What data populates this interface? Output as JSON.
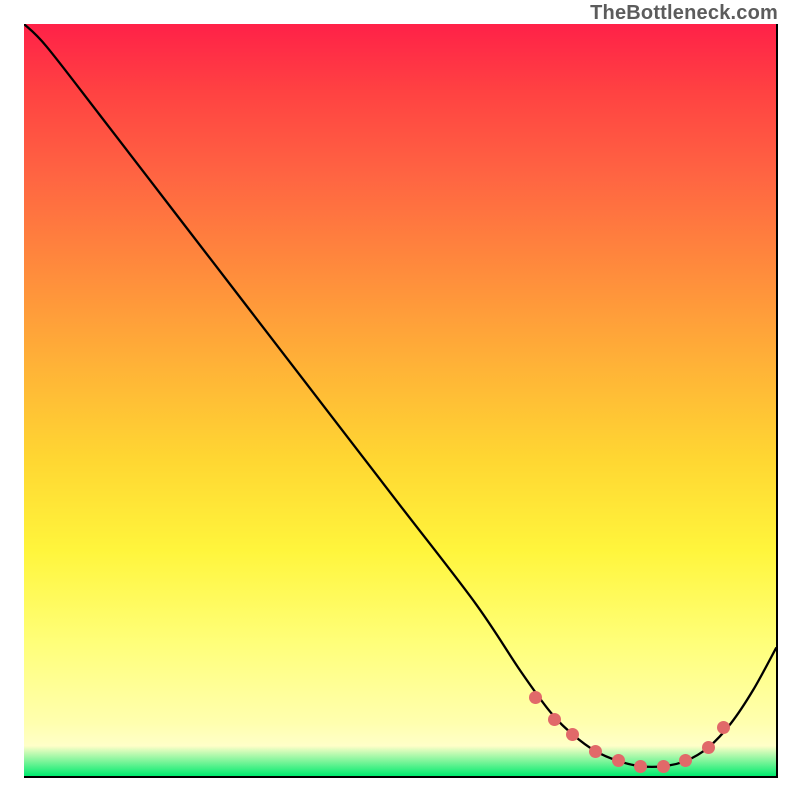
{
  "attribution": "TheBottleneck.com",
  "chart_data": {
    "type": "line",
    "title": "",
    "xlabel": "",
    "ylabel": "",
    "xlim": [
      0,
      100
    ],
    "ylim": [
      0,
      100
    ],
    "series": [
      {
        "name": "curve",
        "x": [
          0,
          3,
          10,
          20,
          30,
          40,
          50,
          60,
          66,
          70,
          73,
          76,
          79,
          82,
          85,
          88,
          91,
          94,
          97,
          100
        ],
        "y": [
          100,
          97,
          88,
          75,
          62,
          49,
          36,
          23,
          14,
          8.5,
          5.5,
          3.3,
          2.0,
          1.3,
          1.3,
          2.0,
          3.8,
          7.0,
          11.5,
          17
        ]
      },
      {
        "name": "markers",
        "x": [
          68.0,
          70.5,
          73.0,
          76.0,
          79.0,
          82.0,
          85.0,
          88.0,
          91.0,
          93.0
        ],
        "y": [
          10.5,
          7.5,
          5.5,
          3.3,
          2.0,
          1.3,
          1.3,
          2.0,
          3.8,
          6.5
        ]
      }
    ],
    "gradient": {
      "type": "vertical",
      "stops": [
        {
          "pos": 0.0,
          "color": "#ff2148"
        },
        {
          "pos": 0.3,
          "color": "#ff8040"
        },
        {
          "pos": 0.6,
          "color": "#ffd830"
        },
        {
          "pos": 0.88,
          "color": "#ffff90"
        },
        {
          "pos": 1.0,
          "color": "#00eb6e"
        }
      ]
    },
    "marker_color": "#e16969",
    "curve_color": "#000000"
  }
}
